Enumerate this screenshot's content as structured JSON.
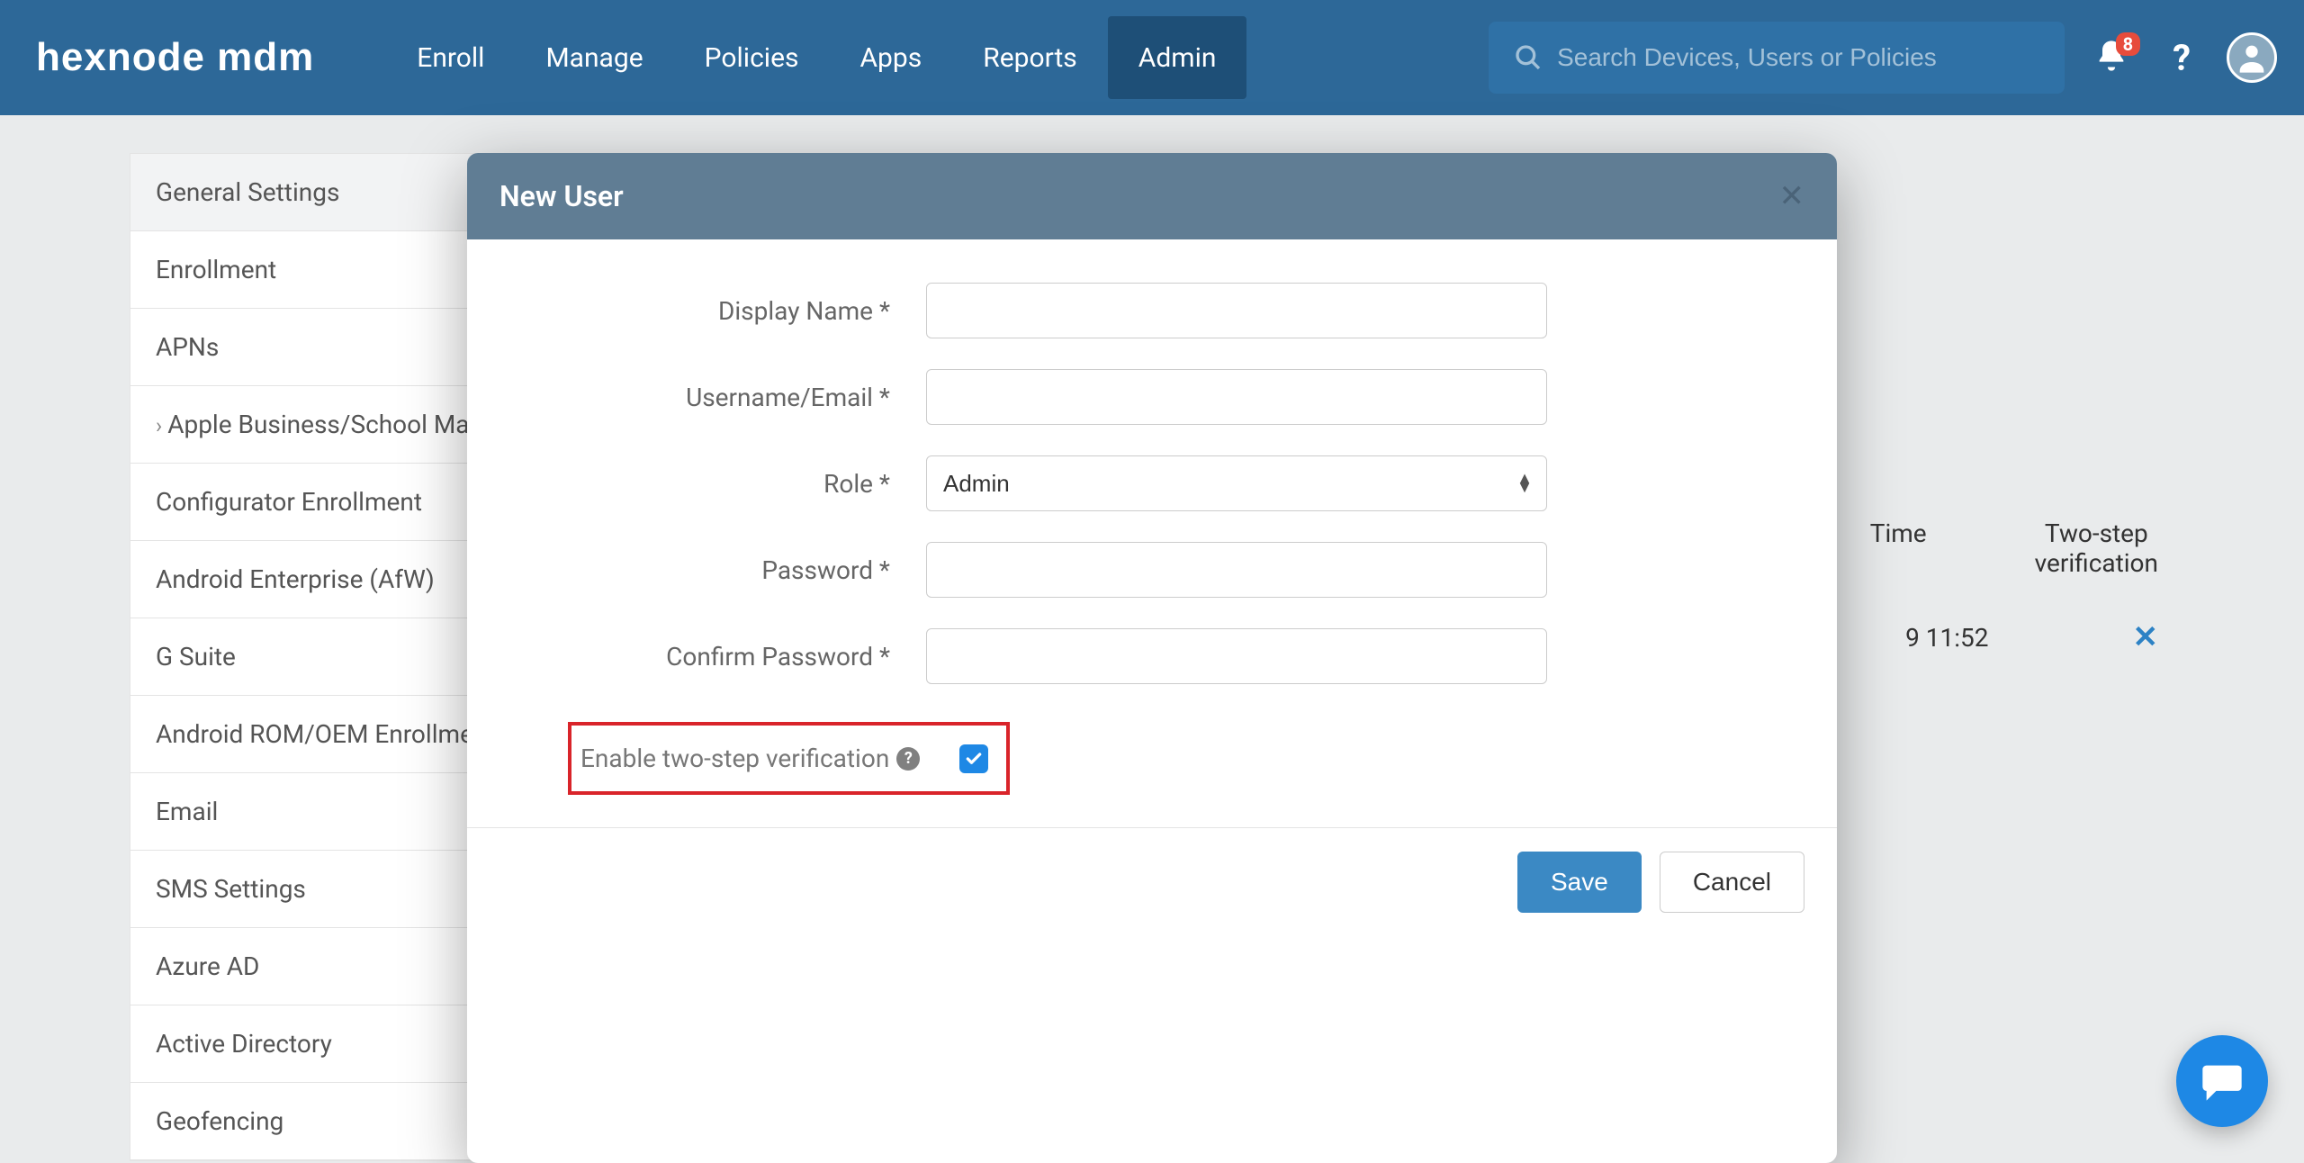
{
  "brand": "hexnode mdm",
  "nav": {
    "items": [
      {
        "label": "Enroll",
        "active": false
      },
      {
        "label": "Manage",
        "active": false
      },
      {
        "label": "Policies",
        "active": false
      },
      {
        "label": "Apps",
        "active": false
      },
      {
        "label": "Reports",
        "active": false
      },
      {
        "label": "Admin",
        "active": true
      }
    ]
  },
  "search": {
    "placeholder": "Search Devices, Users or Policies"
  },
  "notifications": {
    "count": "8"
  },
  "sidebar": {
    "items": [
      {
        "label": "General Settings",
        "active": true
      },
      {
        "label": "Enrollment"
      },
      {
        "label": "APNs"
      },
      {
        "label": "Apple Business/School Manager",
        "chevron": true
      },
      {
        "label": "Configurator Enrollment"
      },
      {
        "label": "Android Enterprise (AfW)"
      },
      {
        "label": "G Suite"
      },
      {
        "label": "Android ROM/OEM Enrollment"
      },
      {
        "label": "Email"
      },
      {
        "label": "SMS Settings"
      },
      {
        "label": "Azure AD"
      },
      {
        "label": "Active Directory"
      },
      {
        "label": "Geofencing"
      }
    ]
  },
  "table": {
    "headers": {
      "time": "Time",
      "twostep": "Two-step\nverification"
    },
    "row0": {
      "time_fragment": "9 11:52",
      "twostep_icon": "✕"
    }
  },
  "modal": {
    "title": "New User",
    "labels": {
      "display_name": "Display Name *",
      "username": "Username/Email *",
      "role": "Role *",
      "password": "Password *",
      "confirm_password": "Confirm Password *",
      "two_step": "Enable two-step verification"
    },
    "role_value": "Admin",
    "buttons": {
      "save": "Save",
      "cancel": "Cancel"
    }
  }
}
